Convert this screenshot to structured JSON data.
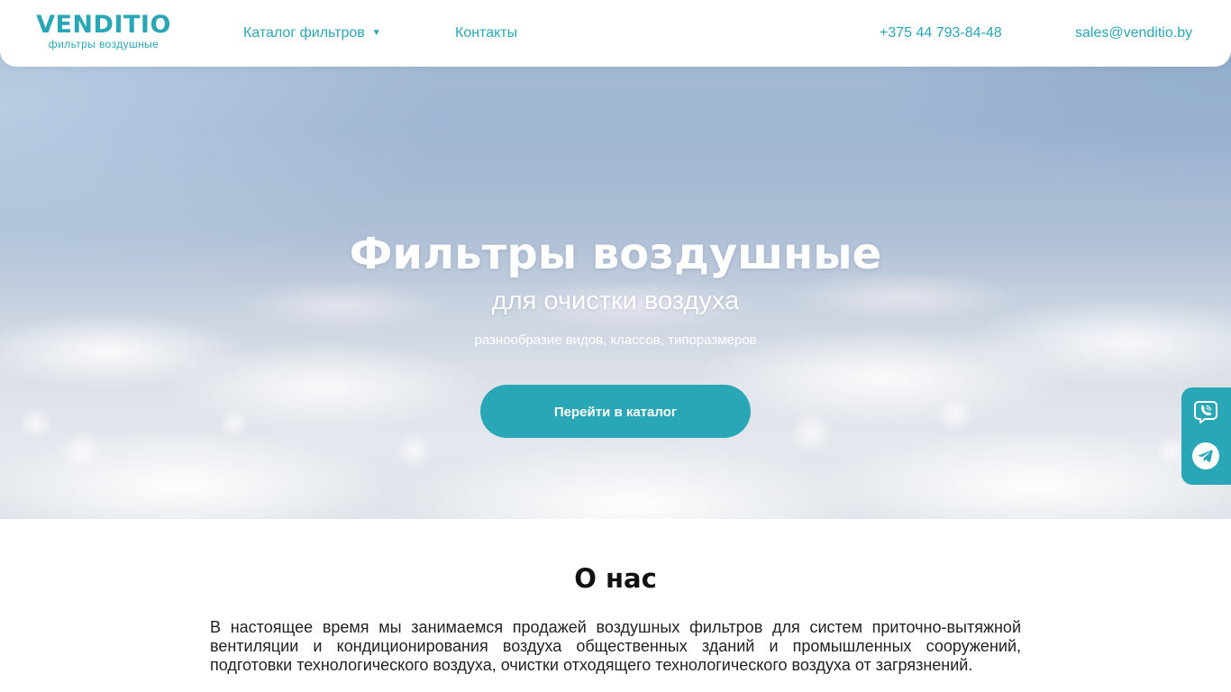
{
  "header": {
    "brand": "VENDITIO",
    "tagline": "фильтры воздушные",
    "nav": {
      "catalog_label": "Каталог фильтров",
      "contacts_label": "Контакты",
      "phone": "+375 44 793-84-48",
      "email": "sales@venditio.by"
    }
  },
  "hero": {
    "title": "Фильтры воздушные",
    "subtitle": "для очистки воздуха",
    "tagline": "разнообразие видов, классов, типоразмеров",
    "cta_label": "Перейти в каталог"
  },
  "messengers": {
    "icons": [
      "viber-icon",
      "telegram-icon"
    ]
  },
  "about": {
    "title": "О нас",
    "text": "В настоящее время мы занимаемся продажей воздушных фильтров для систем приточно-вытяжной вентиляции и кондиционирования воздуха общественных зданий и промышленных сооружений, подготовки технологического воздуха, очистки отходящего технологического воздуха от загрязнений."
  },
  "colors": {
    "accent": "#2aa7b6",
    "text_dark": "#111111",
    "header_bg": "#ffffff"
  }
}
